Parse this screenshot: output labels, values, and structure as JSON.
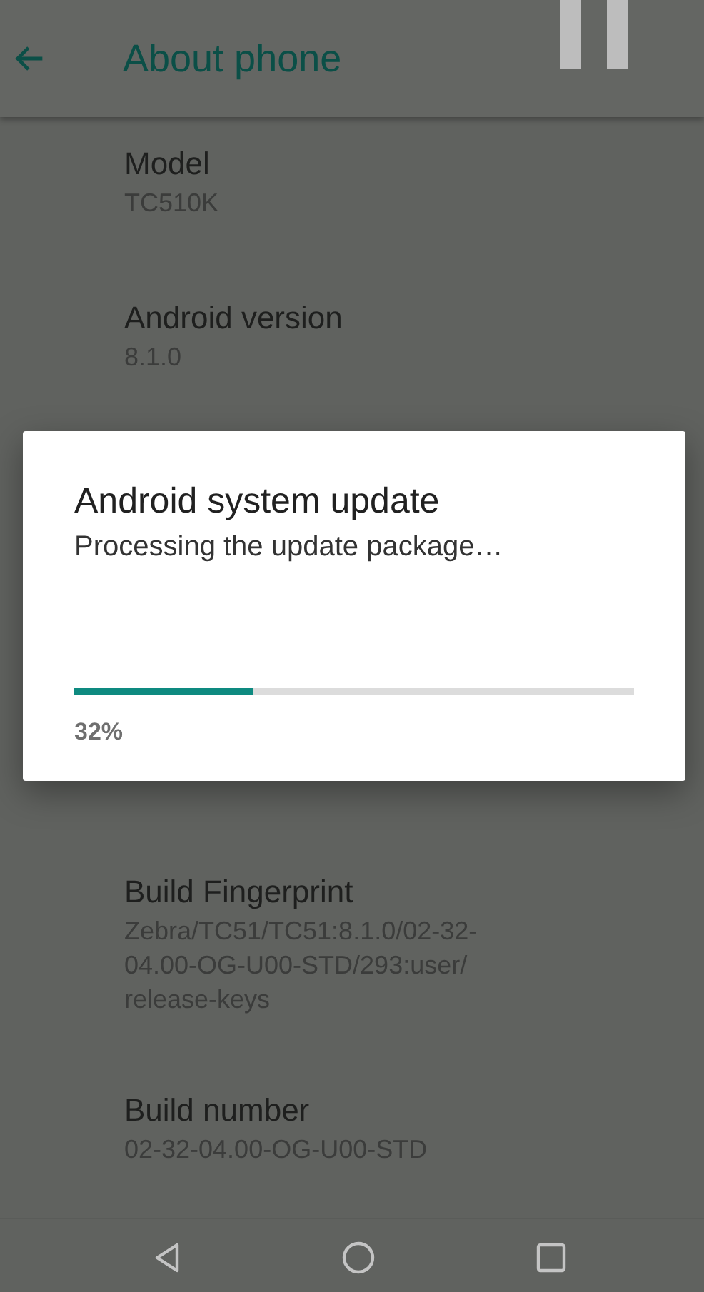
{
  "app_bar": {
    "title": "About phone"
  },
  "items": [
    {
      "title": "Model",
      "summary": [
        "TC510K"
      ]
    },
    {
      "title": "Android version",
      "summary": [
        "8.1.0"
      ]
    },
    {
      "title": "Build Fingerprint",
      "summary": [
        "Zebra/TC51/TC51:8.1.0/02-32-",
        "04.00-OG-U00-STD/293:user/",
        "release-keys"
      ]
    },
    {
      "title": "Build number",
      "summary": [
        "02-32-04.00-OG-U00-STD"
      ]
    }
  ],
  "dialog": {
    "title": "Android system update",
    "message": "Processing the update package…",
    "progress": {
      "level": 0.32
    },
    "percent": "32%"
  }
}
